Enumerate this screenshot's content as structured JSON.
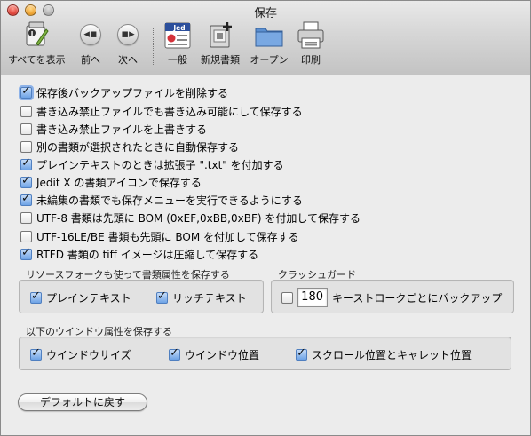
{
  "window": {
    "title": "保存"
  },
  "toolbar": {
    "show_all": "すべてを表示",
    "back": "前へ",
    "forward": "次へ",
    "general": "一般",
    "new_document": "新規書類",
    "open": "オープン",
    "print": "印刷",
    "jedit_icon_text": "Jed"
  },
  "options": [
    {
      "label": "保存後バックアップファイルを削除する",
      "checked": true
    },
    {
      "label": "書き込み禁止ファイルでも書き込み可能にして保存する",
      "checked": false
    },
    {
      "label": "書き込み禁止ファイルを上書きする",
      "checked": false
    },
    {
      "label": "別の書類が選択されたときに自動保存する",
      "checked": false
    },
    {
      "label": "プレインテキストのときは拡張子 \".txt\" を付加する",
      "checked": true
    },
    {
      "label": "Jedit X の書類アイコンで保存する",
      "checked": true
    },
    {
      "label": "未編集の書類でも保存メニューを実行できるようにする",
      "checked": true
    },
    {
      "label": "UTF-8 書類は先頭に BOM (0xEF,0xBB,0xBF) を付加して保存する",
      "checked": false
    },
    {
      "label": "UTF-16LE/BE 書類も先頭に BOM を付加して保存する",
      "checked": false
    },
    {
      "label": "RTFD 書類の tiff イメージは圧縮して保存する",
      "checked": true
    }
  ],
  "resource_fork": {
    "title": "リソースフォークも使って書類属性を保存する",
    "plain_text": {
      "label": "プレインテキスト",
      "checked": true
    },
    "rich_text": {
      "label": "リッチテキスト",
      "checked": true
    }
  },
  "crash_guard": {
    "title": "クラッシュガード",
    "enabled": false,
    "keystrokes": "180",
    "label": "キーストロークごとにバックアップ"
  },
  "window_attributes": {
    "title": "以下のウインドウ属性を保存する",
    "size": {
      "label": "ウインドウサイズ",
      "checked": true
    },
    "position": {
      "label": "ウインドウ位置",
      "checked": true
    },
    "scroll": {
      "label": "スクロール位置とキャレット位置",
      "checked": true
    }
  },
  "defaults_button": "デフォルトに戻す",
  "colors": {
    "checkbox_checked": "#6ea3e6",
    "folder_blue": "#5b8fd0"
  }
}
